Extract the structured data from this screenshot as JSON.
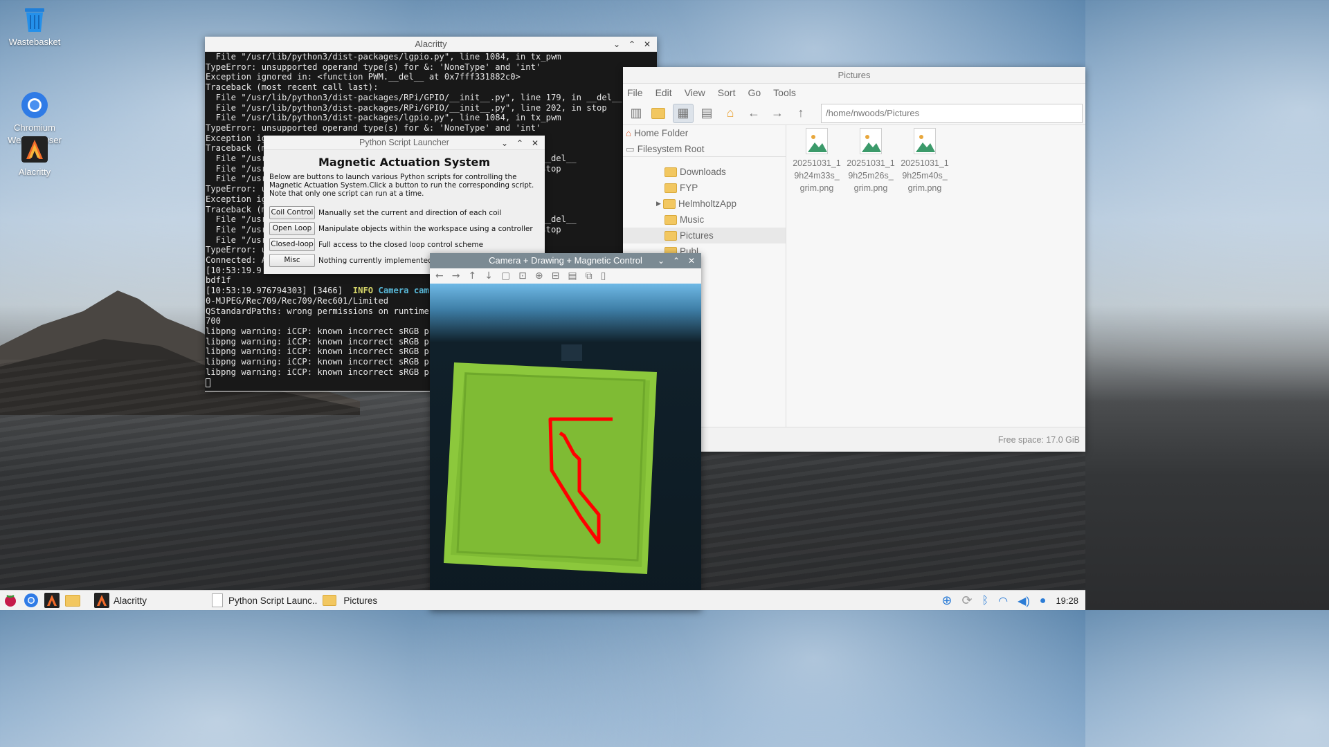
{
  "desktop": {
    "icons": [
      {
        "label": "Wastebasket",
        "icon": "trash-icon"
      },
      {
        "label": "Chromium\nWeb Browser",
        "icon": "chromium-icon"
      },
      {
        "label": "Alacritty",
        "icon": "alacritty-icon"
      }
    ]
  },
  "terminal": {
    "title": "Alacritty",
    "lines": [
      "  File \"/usr/lib/python3/dist-packages/lgpio.py\", line 1084, in tx_pwm",
      "TypeError: unsupported operand type(s) for &: 'NoneType' and 'int'",
      "Exception ignored in: <function PWM.__del__ at 0x7fff331882c0>",
      "Traceback (most recent call last):",
      "  File \"/usr/lib/python3/dist-packages/RPi/GPIO/__init__.py\", line 179, in __del__",
      "  File \"/usr/lib/python3/dist-packages/RPi/GPIO/__init__.py\", line 202, in stop",
      "  File \"/usr/lib/python3/dist-packages/lgpio.py\", line 1084, in tx_pwm",
      "TypeError: unsupported operand type(s) for &: 'NoneType' and 'int'",
      "Exception ig",
      "Traceback (m",
      "  File \"/usr                                              179, in __del__",
      "  File \"/usr                                              202, in stop",
      "  File \"/usr                                              pwm",
      "TypeError: u",
      "Exception ig",
      "Traceback (m",
      "  File \"/usr                                              179, in __del__",
      "  File \"/usr                                              202, in stop",
      "  File \"/usr                                              pwm",
      "TypeError: u",
      "Connected: A",
      "[10:53:19.9",
      "bdf1f",
      "[10:53:19.976794303] [3466]  ",
      "0-MJPEG/Rec709/Rec709/Rec601/Limited",
      "QStandardPaths: wrong permissions on runtime",
      "700",
      "libpng warning: iCCP: known incorrect sRGB p",
      "libpng warning: iCCP: known incorrect sRGB p",
      "libpng warning: iCCP: known incorrect sRGB p",
      "libpng warning: iCCP: known incorrect sRGB p",
      "libpng warning: iCCP: known incorrect sRGB p"
    ],
    "info_tag": "INFO",
    "camera_tag": "Camera",
    "cam_tail": "cam"
  },
  "launcher": {
    "title": "Python Script Launcher",
    "heading": "Magnetic Actuation System",
    "description": "Below are buttons to launch various Python scripts for controlling the Magnetic Actuation System.Click a button to run the corresponding script. Note that only one script can run at a time.",
    "buttons": [
      {
        "label": "Coil Control",
        "desc": "Manually set the current and direction of each coil"
      },
      {
        "label": "Open Loop",
        "desc": "Manipulate objects within the workspace using a controller"
      },
      {
        "label": "Closed-loop",
        "desc": "Full access to the closed loop control scheme"
      },
      {
        "label": "Misc",
        "desc": "Nothing currently implemented"
      }
    ]
  },
  "filemanager": {
    "title": "Pictures",
    "menu": [
      "File",
      "Edit",
      "View",
      "Sort",
      "Go",
      "Tools"
    ],
    "path": "/home/nwoods/Pictures",
    "places": [
      "Home Folder",
      "Filesystem Root"
    ],
    "tree": [
      "Downloads",
      "FYP",
      "HelmholtzApp",
      "Music",
      "Pictures",
      "Public",
      "Templates",
      "Videos"
    ],
    "tree_visible": [
      "Downloads",
      "FYP",
      "HelmholtzApp",
      "Music",
      "Pictures",
      "Publ",
      "lates",
      "s"
    ],
    "files": [
      {
        "name": "20251031_19h24m33s_grim.png",
        "line1": "20251031_1",
        "line2": "9h24m33s_",
        "line3": "grim.png"
      },
      {
        "name": "20251031_19h25m26s_grim.png",
        "line1": "20251031_1",
        "line2": "9h25m26s_",
        "line3": "grim.png"
      },
      {
        "name": "20251031_19h25m40s_grim.png",
        "line1": "20251031_1",
        "line2": "9h25m40s_",
        "line3": "grim.png"
      }
    ],
    "free_space": "Free space: 17.0 GiB"
  },
  "camera": {
    "title": "Camera + Drawing + Magnetic Control"
  },
  "taskbar": {
    "items": [
      {
        "label": "Alacritty",
        "icon": "alacritty-icon"
      },
      {
        "label": "Python Script Launc..",
        "icon": "python-window-icon"
      },
      {
        "label": "Pictures",
        "icon": "folder-icon"
      }
    ],
    "clock": "19:28"
  },
  "colors": {
    "terminal_bg": "#181818",
    "drawing_red": "#ff0000",
    "plate_green": "#8cc83c"
  }
}
